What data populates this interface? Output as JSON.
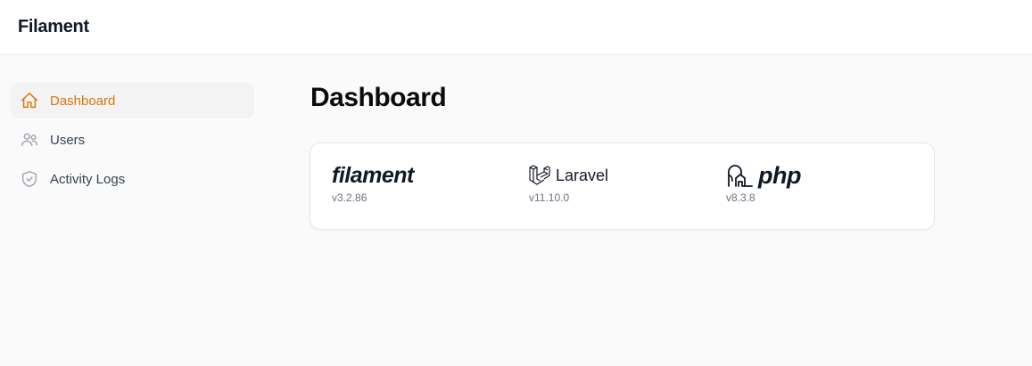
{
  "app": {
    "brand": "Filament"
  },
  "sidebar": {
    "items": [
      {
        "label": "Dashboard",
        "icon": "home-icon",
        "active": true
      },
      {
        "label": "Users",
        "icon": "users-icon",
        "active": false
      },
      {
        "label": "Activity Logs",
        "icon": "shield-check-icon",
        "active": false
      }
    ]
  },
  "main": {
    "title": "Dashboard",
    "info_card": {
      "filament": {
        "name": "filament",
        "version": "v3.2.86"
      },
      "laravel": {
        "name": "Laravel",
        "version": "v11.10.0"
      },
      "php": {
        "name": "php",
        "version": "v8.3.8"
      }
    }
  },
  "colors": {
    "accent": "#d97706",
    "text": "#111827",
    "muted": "#6b7280"
  }
}
